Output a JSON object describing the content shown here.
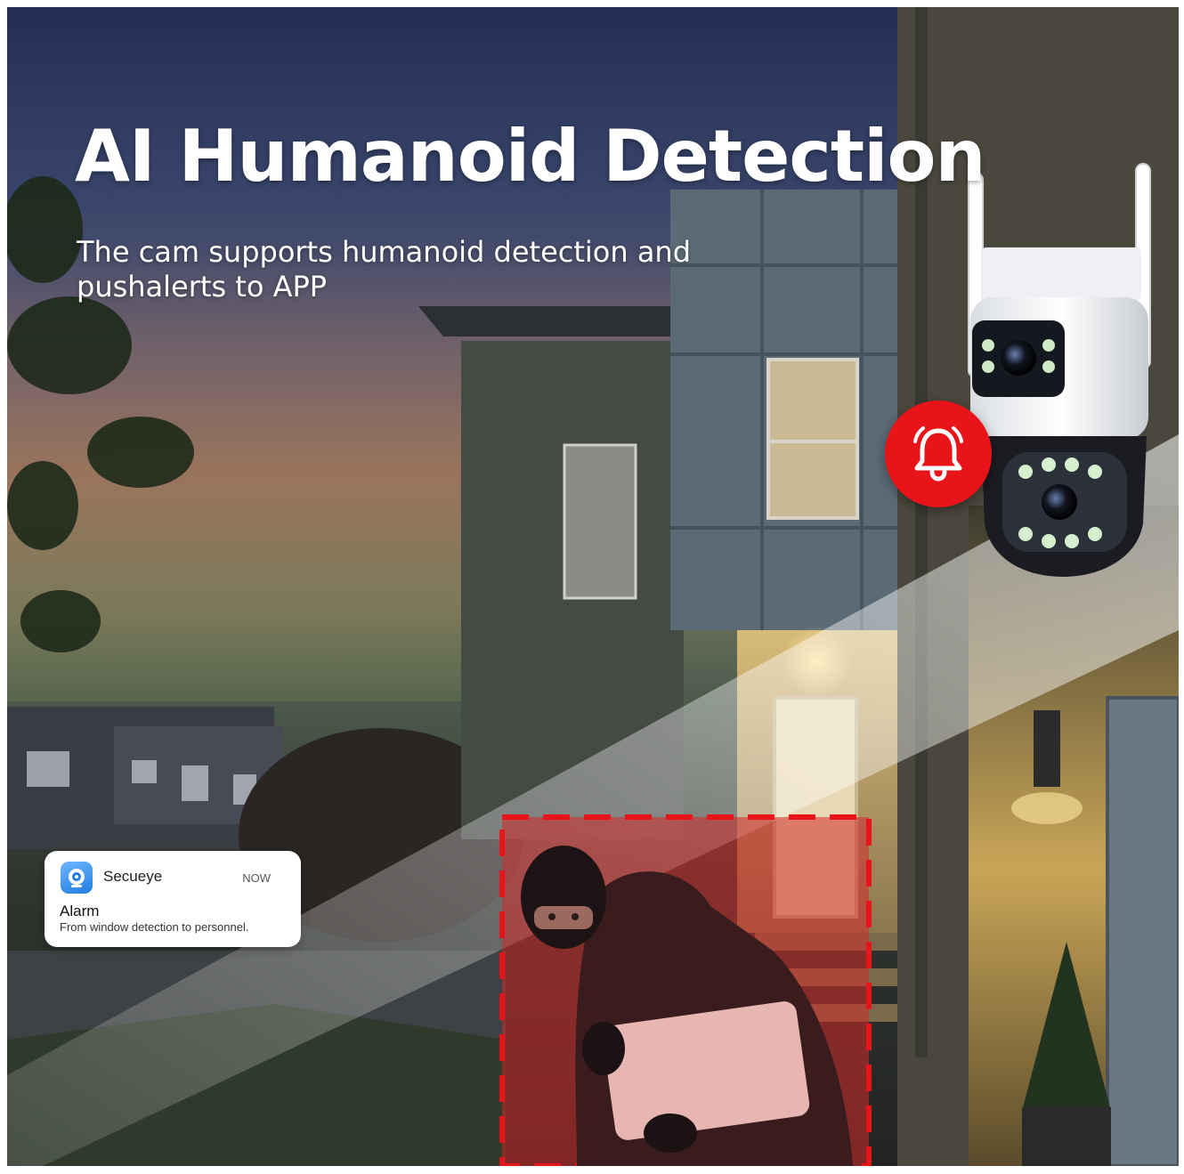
{
  "headline": "AI Humanoid Detection",
  "subheadline_lines": [
    "The cam supports humanoid detection and",
    "pushalerts to APP"
  ],
  "notification": {
    "app_name": "Secueye",
    "time": "NOW",
    "title": "Alarm",
    "body": "From window detection to personnel.",
    "app_icon": "camera-eye-icon"
  },
  "alarm_badge": {
    "icon": "bell-icon",
    "color": "#e8141a"
  },
  "detection_box": {
    "border_color": "#e8141a",
    "fill_color": "#d22a2a",
    "style": "dashed"
  },
  "colors": {
    "text": "#ffffff",
    "alert": "#e8141a",
    "card": "#ffffff",
    "app_icon": "#2b8cf0"
  }
}
